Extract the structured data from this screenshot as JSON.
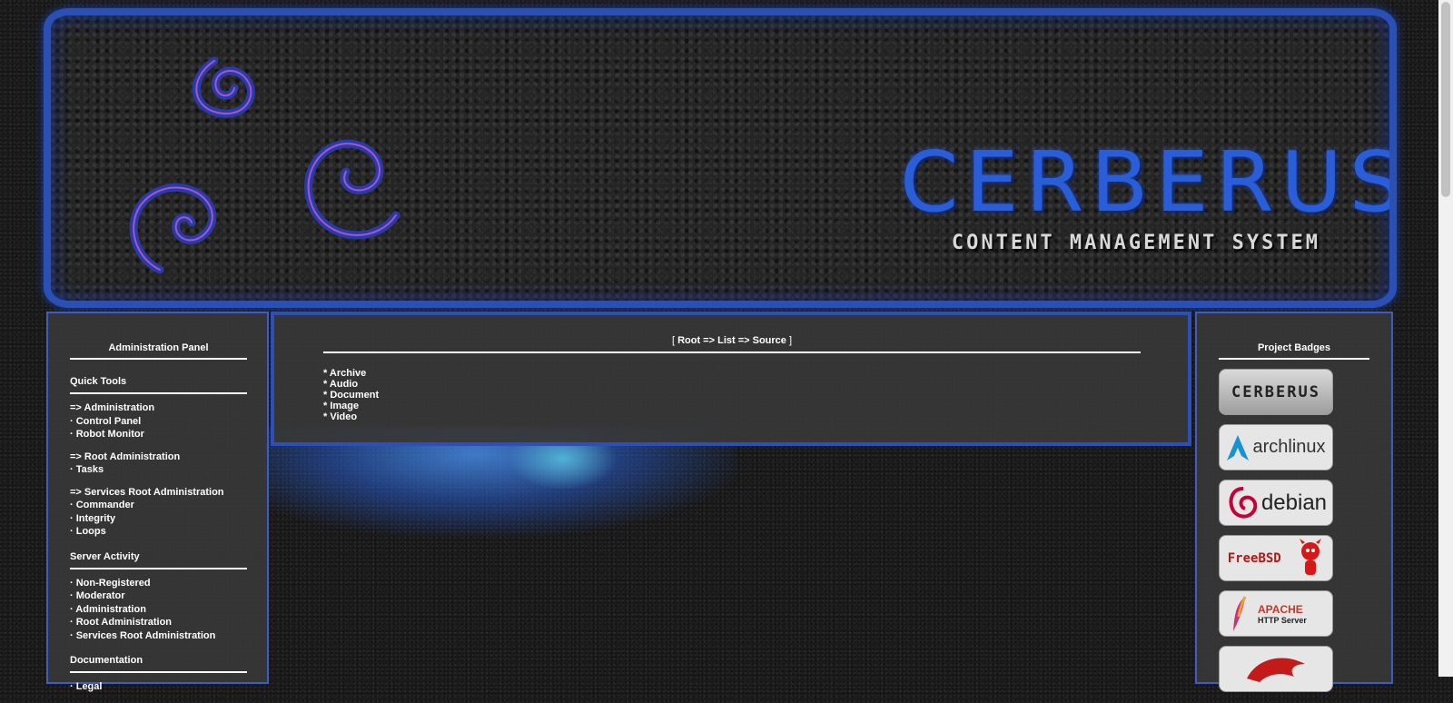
{
  "header": {
    "brand_title": "CERBERUS",
    "brand_subtitle": "CONTENT MANAGEMENT SYSTEM",
    "logo_icon": "triskelion-swirl-icon",
    "accent_color": "#2a5ed8"
  },
  "left_panel": {
    "title": "Administration Panel",
    "quick_tools": {
      "title": "Quick Tools",
      "groups": [
        {
          "heading": "=> Administration",
          "items": [
            "· Control Panel",
            "· Robot Monitor"
          ]
        },
        {
          "heading": "=> Root Administration",
          "items": [
            "· Tasks"
          ]
        },
        {
          "heading": "=> Services Root Administration",
          "items": [
            "· Commander",
            "· Integrity",
            "· Loops"
          ]
        }
      ]
    },
    "server_activity": {
      "title": "Server Activity",
      "items": [
        "· Non-Registered",
        "· Moderator",
        "· Administration",
        "· Root Administration",
        "· Services Root Administration"
      ]
    },
    "documentation": {
      "title": "Documentation",
      "items": [
        "· Legal"
      ]
    }
  },
  "main": {
    "breadcrumb_open": "[ ",
    "breadcrumb": {
      "root": "Root",
      "sep1": " => ",
      "list": "List",
      "sep2": " => ",
      "source": "Source"
    },
    "breadcrumb_close": " ]",
    "categories": [
      "* Archive",
      "* Audio",
      "* Document",
      "* Image",
      "* Video"
    ]
  },
  "right_panel": {
    "title": "Project Badges",
    "badges": [
      {
        "icon": "cerberus-badge-icon",
        "label": "CERBERUS"
      },
      {
        "icon": "archlinux-badge-icon",
        "label": "archlinux"
      },
      {
        "icon": "debian-badge-icon",
        "label": "debian"
      },
      {
        "icon": "freebsd-badge-icon",
        "label": "FreeBSD"
      },
      {
        "icon": "apache-badge-icon",
        "label": "APACHE",
        "sublabel": "HTTP Server"
      },
      {
        "icon": "red-creature-badge-icon",
        "label": ""
      }
    ]
  }
}
